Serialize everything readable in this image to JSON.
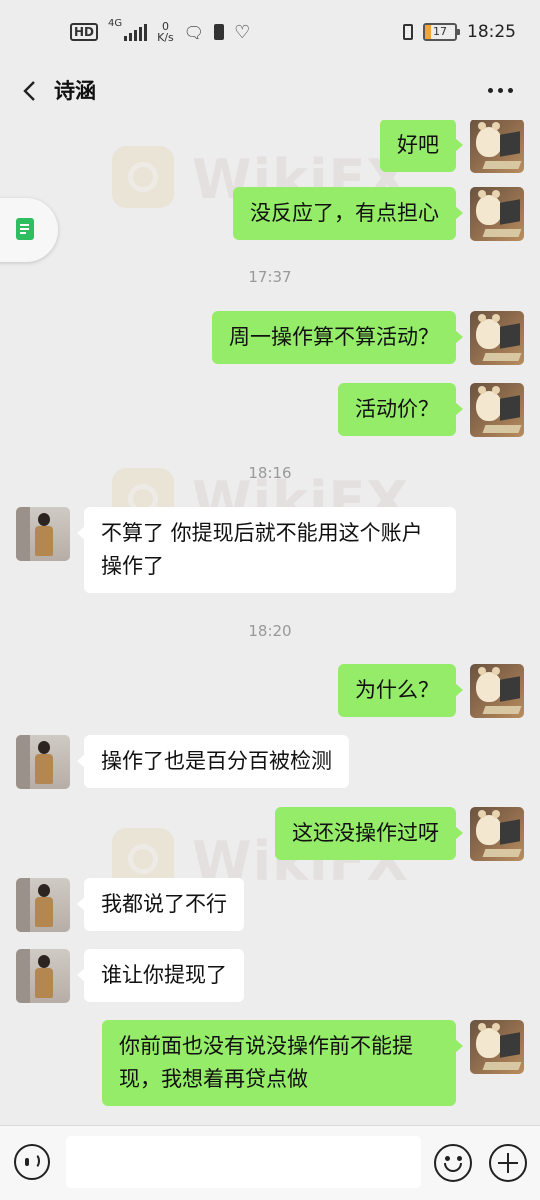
{
  "status_bar": {
    "hd": "HD",
    "network_type": "4G",
    "speed_value": "0",
    "speed_unit": "K/s",
    "battery": "17",
    "time": "18:25"
  },
  "header": {
    "title": "诗涵",
    "back_icon": "chevron-left-icon",
    "more_icon": "more-dots-icon"
  },
  "side_tab": {
    "icon": "document-icon",
    "color": "#2dbe60"
  },
  "colors": {
    "my_bubble": "#95ec69",
    "their_bubble": "#ffffff",
    "background": "#ededed"
  },
  "messages": [
    {
      "sender": "me",
      "text": "好吧"
    },
    {
      "sender": "me",
      "text": "没反应了，有点担心"
    },
    {
      "type": "time",
      "text": "17:37"
    },
    {
      "sender": "me",
      "text": "周一操作算不算活动？"
    },
    {
      "sender": "me",
      "text": "活动价？"
    },
    {
      "type": "time",
      "text": "18:16"
    },
    {
      "sender": "other",
      "text": "不算了 你提现后就不能用这个账户操作了"
    },
    {
      "type": "time",
      "text": "18:20"
    },
    {
      "sender": "me",
      "text": "为什么？"
    },
    {
      "sender": "other",
      "text": "操作了也是百分百被检测"
    },
    {
      "sender": "me",
      "text": "这还没操作过呀"
    },
    {
      "sender": "other",
      "text": "我都说了不行"
    },
    {
      "sender": "other",
      "text": "谁让你提现了"
    },
    {
      "sender": "me",
      "text": "你前面也没有说没操作前不能提现，我想着再贷点做"
    }
  ],
  "watermark": {
    "text": "WikiFX"
  },
  "input_bar": {
    "placeholder": "",
    "voice_icon": "voice-icon",
    "emoji_icon": "emoji-icon",
    "plus_icon": "plus-icon"
  }
}
